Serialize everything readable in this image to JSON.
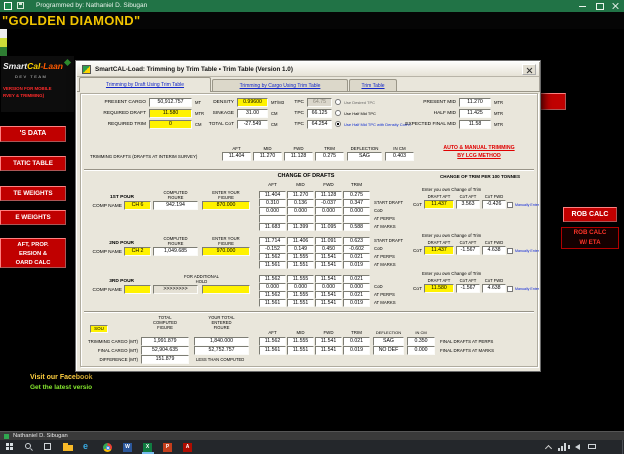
{
  "app": {
    "titlebar_title": "Programmed by: Nathaniel D. Sibugan",
    "ship_name": "\"GOLDEN DIAMOND\"",
    "statusbar_user": "Nathaniel D. Sibugan"
  },
  "logo": {
    "brand_a": "Smart",
    "brand_b": "Cal",
    "brand_c": "-Laan",
    "team": "DEV TEAM",
    "tagline1": "VERSION FOR MOBILE",
    "tagline2": "RVEY & TRIMMING)"
  },
  "left_buttons": [
    "'S DATA",
    "TATIC TABLE",
    "TE WEIGHTS",
    "E WEIGHTS"
  ],
  "draft_button_lines": [
    "AFT, PROP.",
    "ERSION &",
    "OARD CALC"
  ],
  "rob_calc_label": "ROB CALC",
  "rob_eta_lines": [
    "ROB CALC",
    "W/ ETA"
  ],
  "footer": {
    "line1": "Visit our Facebook",
    "line2": "Get the latest versio"
  },
  "taskbar": {
    "icons": [
      {
        "name": "start",
        "glyph": ""
      },
      {
        "name": "search",
        "glyph": ""
      },
      {
        "name": "task-view",
        "glyph": ""
      },
      {
        "name": "file-explorer",
        "glyph": ""
      },
      {
        "name": "edge",
        "glyph": "e"
      },
      {
        "name": "chrome",
        "glyph": ""
      },
      {
        "name": "word",
        "glyph": "W"
      },
      {
        "name": "excel",
        "glyph": "X"
      },
      {
        "name": "powerpoint",
        "glyph": "P"
      },
      {
        "name": "pdf",
        "glyph": "A"
      }
    ],
    "tray": [
      "chevron-up",
      "network",
      "volume",
      "battery",
      "show-desktop"
    ]
  },
  "dialog": {
    "title": "SmartCAL-Load: Trimming by Trim Table    •    Trim Table  (Version 1.0)",
    "tabs": [
      "Trimming by Draft Using Trim Table",
      "Trimming by Cargo Using Trim Table",
      "Trim Table"
    ],
    "form": {
      "selected_radio": 2,
      "rows": [
        {
          "l1": "PRESENT CARGO",
          "v1": "50,912.757",
          "u1": "MT",
          "l2": "DENSITY",
          "v2": "0.99600",
          "u2": "MT/M3",
          "l3": "TPC",
          "v3": "64.75",
          "radio": "Use Desired TPC",
          "l4": "PRESENT MID",
          "v4": "11.270",
          "u4": "MTR"
        },
        {
          "l1": "REQUIRED DRAFT",
          "v1": "11.580",
          "u1": "MTR",
          "l2": "SINKAGE",
          "v2": "31.00",
          "u2": "CM",
          "l3": "TPC",
          "v3": "66.125",
          "radio": "Use Half Mid TPC",
          "l4": "HALF MID",
          "v4": "11.425",
          "u4": "MTR"
        },
        {
          "l1": "REQUIRED TRIM",
          "v1": "0",
          "u1": "CM",
          "l2": "TOTAL CoT",
          "v2": "-27.549",
          "u2": "CM",
          "l3": "TPC",
          "v3": "64.254",
          "radio": "Use Half Mid TPC with Density Corr'n",
          "l4": "EXPECTED FINAL MID",
          "v4": "11.58",
          "u4": "MTR"
        }
      ]
    },
    "interim": {
      "label": "TRIMMING DRAFTS (DRAFTS AT INTERIM SURVEY)",
      "headers": [
        "AFT",
        "MID",
        "FWD",
        "TRIM",
        "DEFLECTION",
        "IN CM"
      ],
      "values": [
        "11.404",
        "11.270",
        "11.128",
        "0.275",
        "SAG",
        "0.403"
      ],
      "note1": "AUTO & MANUAL TRIMMING",
      "note2": "BY LCG METHOD"
    },
    "cod": {
      "title": "CHANGE OF DRAFTS",
      "cot_title": "CHANGE OF TRIM PER 100 TONNES",
      "cols": [
        "AFT",
        "MID",
        "FWD",
        "TRIM"
      ],
      "enter_own": "Enter you own Change of Trim",
      "cot_heads": [
        "DRAFT AFT",
        "CoT AFT",
        "CoT FWD"
      ],
      "cot_label": "CoT",
      "manual": "Manually Enter CoT",
      "comp_name": "COMP NAME",
      "computed_h1": "COMPUTED",
      "computed_h2": "FIGURE",
      "entered_h1": "ENTER YOUR",
      "entered_h2": "FIGURE"
    },
    "pours": [
      {
        "name": "1ST POUR",
        "comp": "CH 6",
        "computed": "942.194",
        "entered": "870.000",
        "rows": [
          {
            "c": [
              "11.404",
              "11.270",
              "11.128",
              "0.275"
            ],
            "label": ""
          },
          {
            "c": [
              "0.310",
              "0.136",
              "-0.037",
              "0.347"
            ],
            "label": "START DRAFT"
          },
          {
            "c": [
              "0.000",
              "0.000",
              "0.000",
              "0.000"
            ],
            "label": "CoD"
          },
          {
            "c": [
              "",
              "",
              "",
              ""
            ],
            "label": "AT PERPS"
          },
          {
            "c": [
              "11.683",
              "11.399",
              "11.095",
              "0.588"
            ],
            "label": "AT MARKS"
          }
        ],
        "cot": [
          "11.437",
          "3.563",
          "-0.426"
        ]
      },
      {
        "name": "2ND POUR",
        "comp": "CH 2",
        "computed": "1,049.685",
        "entered": "970.000",
        "rows": [
          {
            "c": [
              "11.714",
              "11.406",
              "11.091",
              "0.623"
            ],
            "label": "START DRAFT"
          },
          {
            "c": [
              "-0.152",
              "0.149",
              "0.450",
              "-0.602"
            ],
            "label": "CoD"
          },
          {
            "c": [
              "11.562",
              "11.555",
              "11.541",
              "0.021"
            ],
            "label": "AT PERPS"
          },
          {
            "c": [
              "11.561",
              "11.551",
              "11.541",
              "0.019"
            ],
            "label": "AT MARKS"
          }
        ],
        "cot": [
          "11.437",
          "-1.567",
          "4.638"
        ]
      },
      {
        "name": "3RD POUR",
        "extra1": "FOR ADDITIONAL",
        "extra2": "HOLD",
        "comp": "",
        "computed": ">>>>>>>>",
        "entered": "",
        "rows": [
          {
            "c": [
              "11.562",
              "11.555",
              "11.541",
              "0.021"
            ],
            "label": ""
          },
          {
            "c": [
              "0.000",
              "0.000",
              "0.000",
              "0.000"
            ],
            "label": "CoD"
          },
          {
            "c": [
              "11.562",
              "11.555",
              "11.541",
              "0.021"
            ],
            "label": "AT PERPS"
          },
          {
            "c": [
              "11.561",
              "11.551",
              "11.541",
              "0.019"
            ],
            "label": "AT MARKS"
          }
        ],
        "cot": [
          "11.580",
          "-1.567",
          "4.638"
        ]
      }
    ],
    "summary": {
      "h1": [
        "TOTAL",
        "COMPUTED",
        "FIGURE"
      ],
      "h2": [
        "YOUR TOTAL",
        "ENTERED",
        "FIGURE"
      ],
      "rows": [
        {
          "label": "TRIMMING CARGO (MT)",
          "computed": "1,991.879",
          "entered": "1,840.000"
        },
        {
          "label": "FINAL CARGO (MT)",
          "computed": "52,904.635",
          "entered": "52,752.757"
        },
        {
          "label": "DIFFERENCE (MT)",
          "computed": "151.879",
          "note": "LESS THAN COMPUTED"
        }
      ],
      "final_rows": [
        {
          "c": [
            "11.562",
            "11.555",
            "11.541",
            "0.021"
          ],
          "defl": "SAG",
          "cm": "0.350",
          "label": "FINAL DRAFTS AT PERPS"
        },
        {
          "c": [
            "11.561",
            "11.551",
            "11.541",
            "0.019"
          ],
          "defl": "NO DEF",
          "cm": "0.000",
          "label": "FINAL DRAFTS AT MARKS"
        }
      ],
      "sou": "SOU"
    }
  }
}
